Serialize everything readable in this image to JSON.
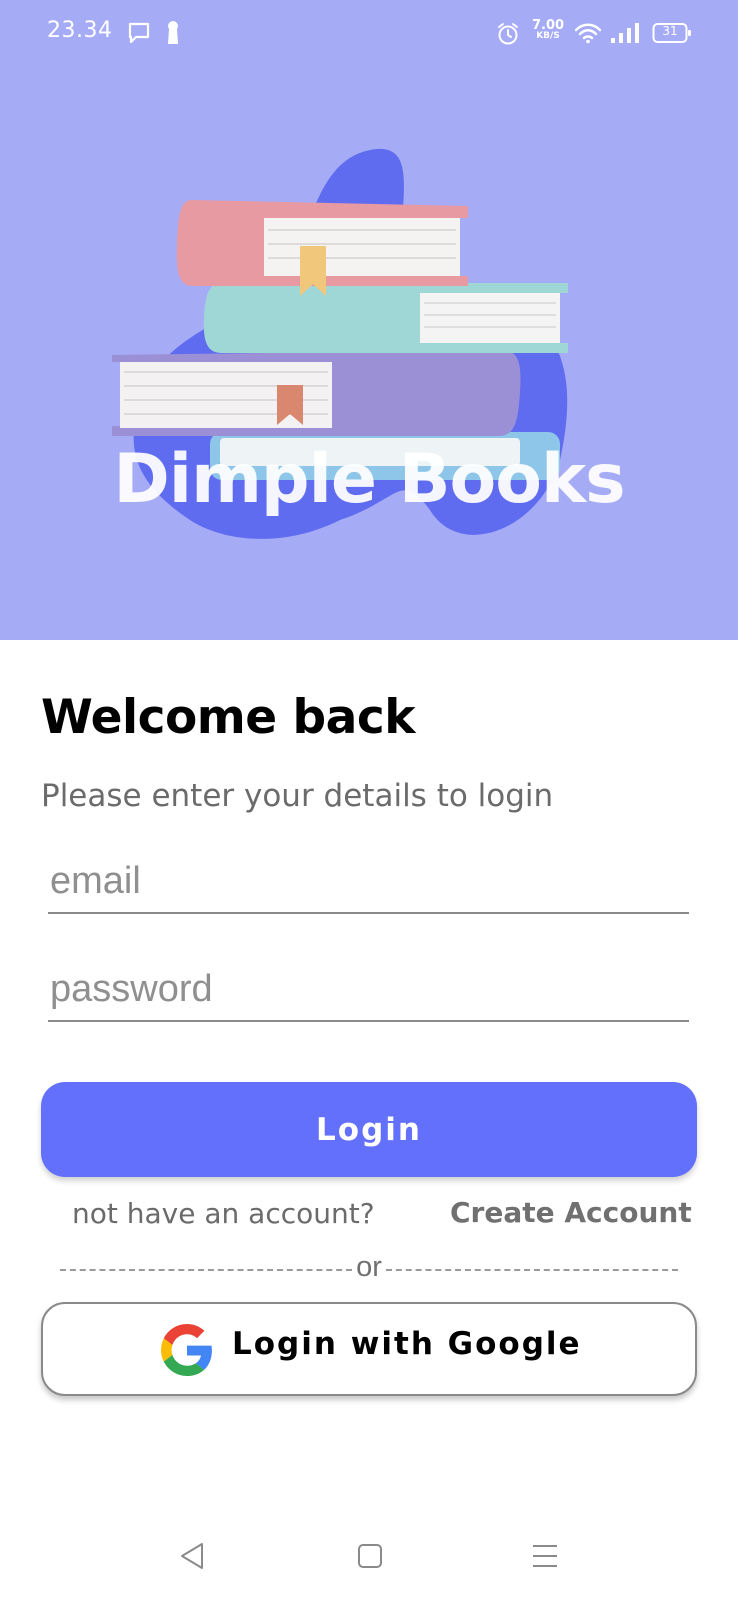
{
  "status_bar": {
    "time": "23.34",
    "network_speed_value": "7.00",
    "network_speed_unit": "KB/S",
    "battery_level": "31",
    "icons": [
      "message-icon",
      "keyhole-icon",
      "alarm-icon",
      "wifi-icon",
      "signal-icon",
      "battery-icon"
    ]
  },
  "hero": {
    "brand_title": "Dimple Books",
    "colors": {
      "background": "#a6abf5",
      "blob": "#5f6cf0",
      "book_pink": "#e89aa3",
      "book_teal": "#9fd6d6",
      "book_purple": "#9b8fd6",
      "book_blue": "#8ec6ea"
    }
  },
  "login": {
    "heading": "Welcome back",
    "subheading": "Please enter your details to login",
    "email": {
      "placeholder": "email",
      "value": ""
    },
    "password": {
      "placeholder": "password",
      "value": ""
    },
    "login_button": "Login",
    "no_account_text": "not have an account?",
    "create_account_link": "Create Account",
    "divider_text": "or",
    "google_button": "Login with Google",
    "accent_color": "#6370fc"
  },
  "nav_bar": {
    "icons": [
      "back-icon",
      "home-icon",
      "menu-icon"
    ]
  }
}
